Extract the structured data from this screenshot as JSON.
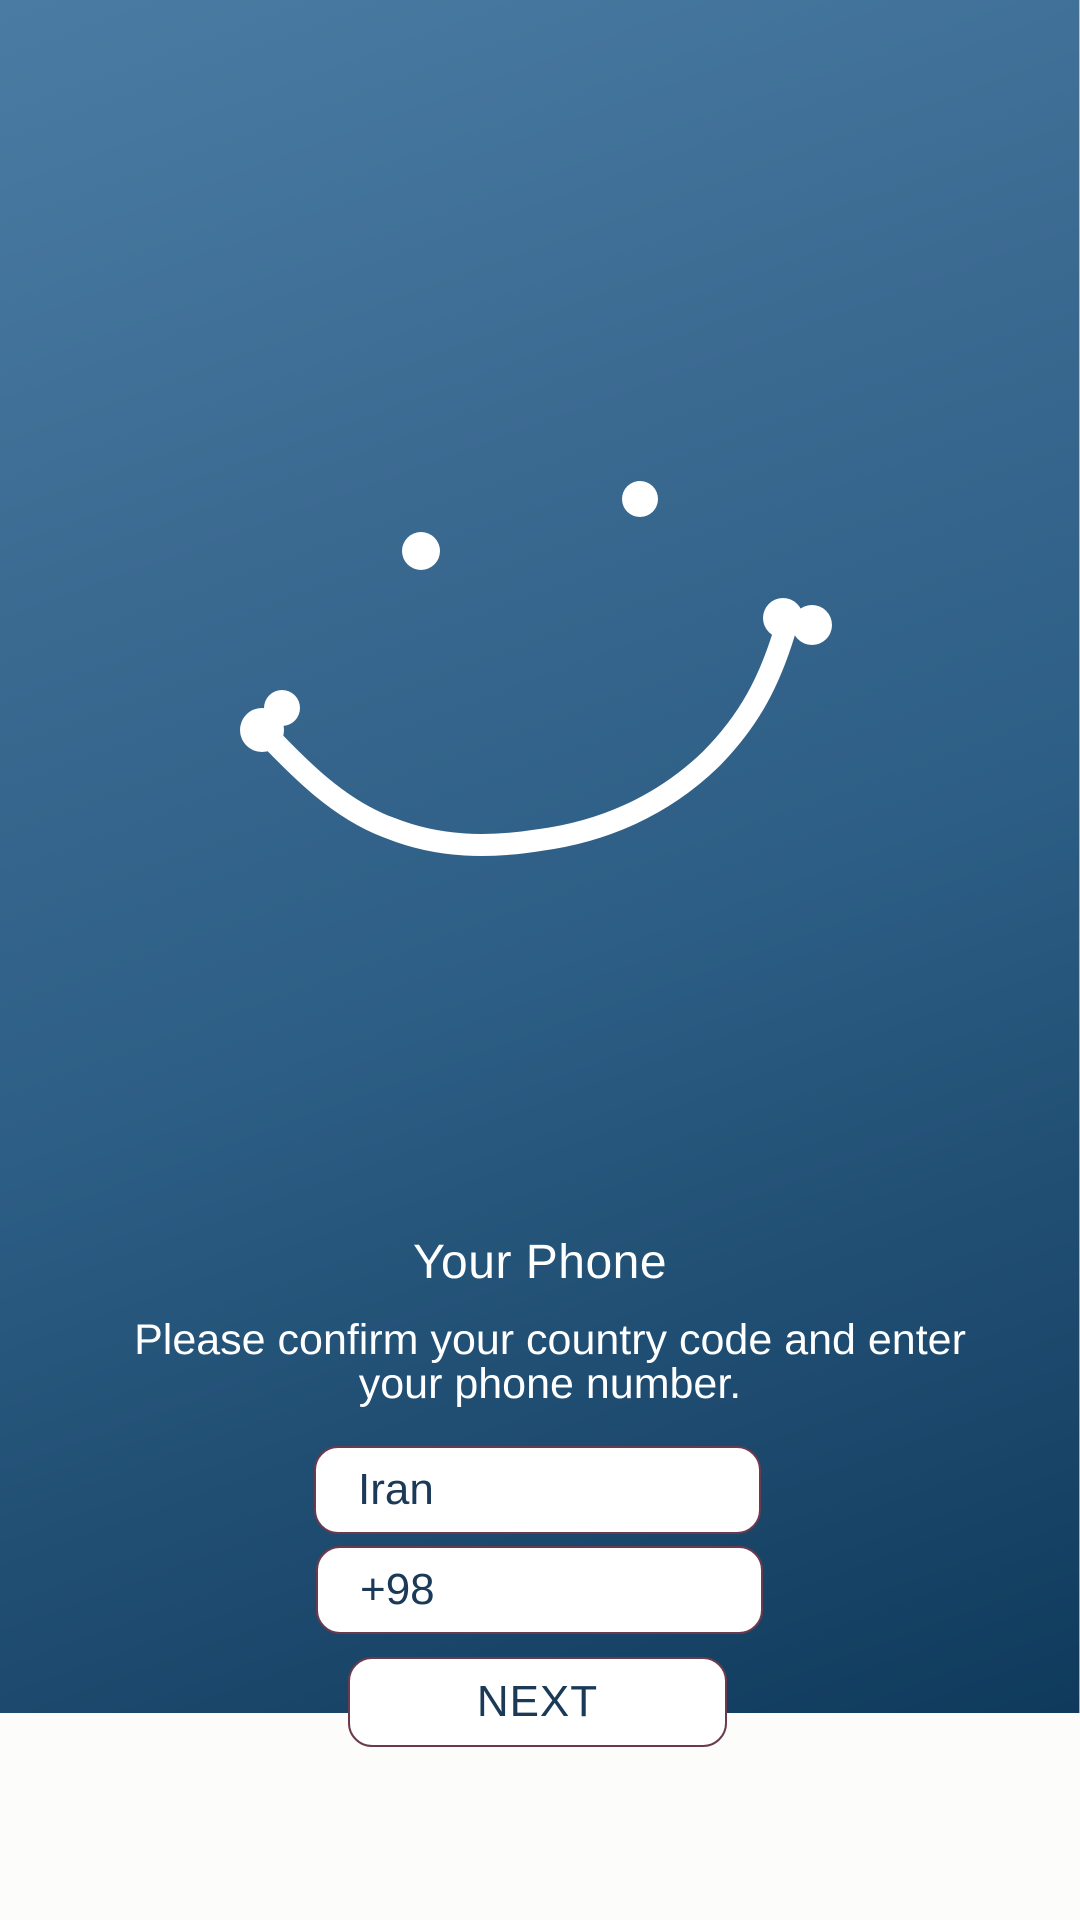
{
  "header": {
    "title": "Your Phone",
    "instructions": "Please confirm your country code and enter your phone number."
  },
  "form": {
    "country_value": "Iran",
    "country_code_value": "+98",
    "next_label": "NEXT"
  },
  "illustration": {
    "icon": "smiley-face-icon"
  },
  "colors": {
    "gradient_top": "#4a7ca3",
    "gradient_bottom": "#0f3a5c",
    "field_border": "#6b3a4e",
    "field_text": "#1b3a57",
    "bottom_background": "#fcfcfb"
  }
}
